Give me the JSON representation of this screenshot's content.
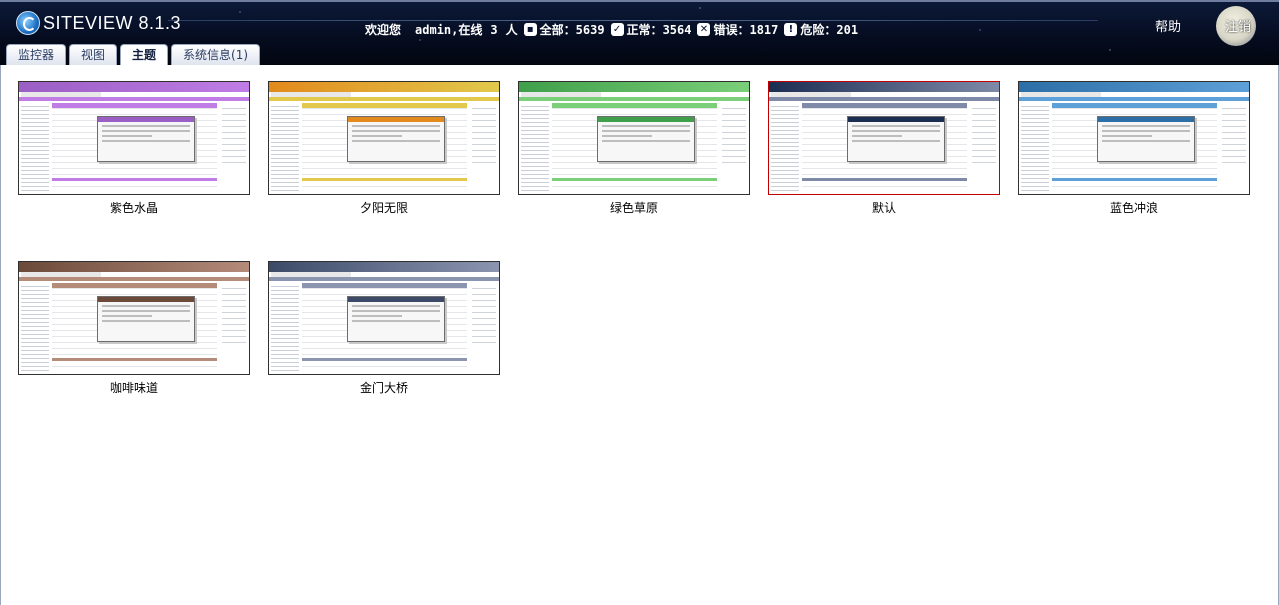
{
  "header": {
    "logo_text": "SITEVIEW 8.1.3",
    "welcome": "欢迎您",
    "user": "admin",
    "online_prefix": ",在线",
    "online_count": "3",
    "online_suffix": "人",
    "total_label": "全部：",
    "total": "5639",
    "ok_label": "正常：",
    "ok": "3564",
    "error_label": "错误：",
    "error": "1817",
    "danger_label": "危险：",
    "danger": "201",
    "help": "帮助",
    "logout": "注销"
  },
  "tabs": [
    {
      "label": "监控器",
      "active": false
    },
    {
      "label": "视图",
      "active": false
    },
    {
      "label": "主题",
      "active": true
    },
    {
      "label": "系统信息(1)",
      "active": false
    }
  ],
  "themes": [
    {
      "name": "紫色水晶",
      "accent": "#9a5ec4",
      "bar": "#c07de6",
      "selected": false
    },
    {
      "name": "夕阳无限",
      "accent": "#e28a1c",
      "bar": "#e2c94c",
      "selected": false
    },
    {
      "name": "绿色草原",
      "accent": "#3f9f4a",
      "bar": "#7bcf79",
      "selected": false
    },
    {
      "name": "默认",
      "accent": "#1c2d52",
      "bar": "#7f8aa8",
      "selected": true
    },
    {
      "name": "蓝色冲浪",
      "accent": "#2c6ea6",
      "bar": "#5da1d8",
      "selected": false
    },
    {
      "name": "咖啡味道",
      "accent": "#6b4a3a",
      "bar": "#b58b7a",
      "selected": false
    },
    {
      "name": "金门大桥",
      "accent": "#3c4a68",
      "bar": "#8b95b0",
      "selected": false
    }
  ]
}
